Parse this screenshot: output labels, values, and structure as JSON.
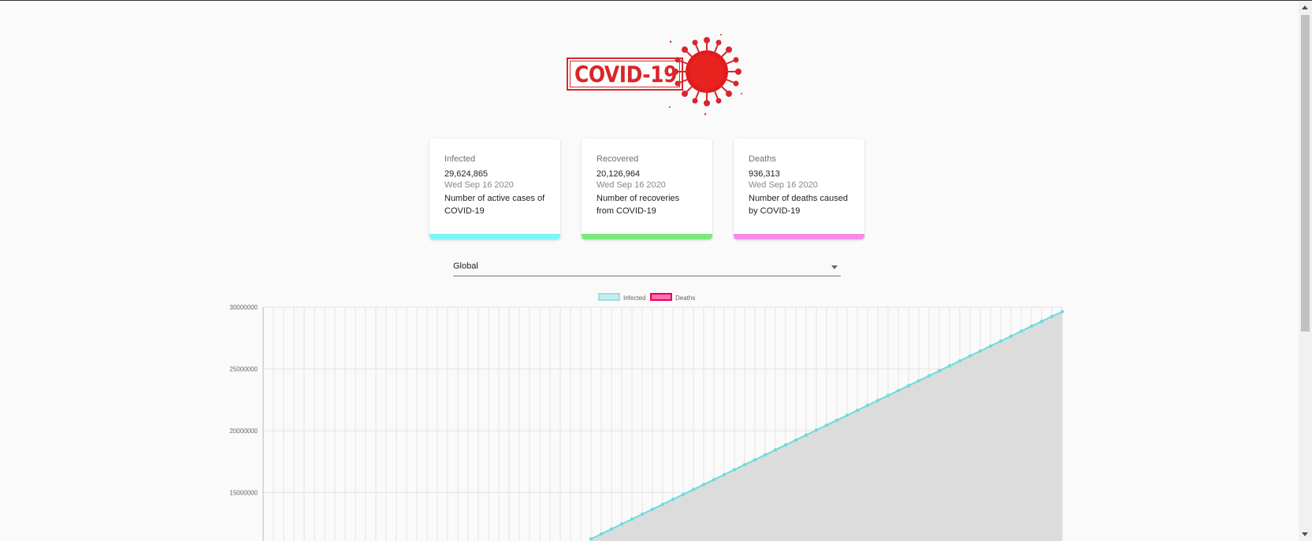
{
  "logo": {
    "text": "COVID-19",
    "icon": "virus-icon",
    "color": "#d8262b"
  },
  "cards": [
    {
      "title": "Infected",
      "value": "29,624,865",
      "date": "Wed Sep 16 2020",
      "desc": "Number of active cases of COVID-19",
      "color": "#7ff4f8"
    },
    {
      "title": "Recovered",
      "value": "20,126,964",
      "date": "Wed Sep 16 2020",
      "desc": "Number of recoveries from COVID-19",
      "color": "#7be87b"
    },
    {
      "title": "Deaths",
      "value": "936,313",
      "date": "Wed Sep 16 2020",
      "desc": "Number of deaths caused by COVID-19",
      "color": "#f48be8"
    }
  ],
  "country_select": {
    "value": "Global"
  },
  "chart_data": {
    "type": "line",
    "legend": [
      {
        "name": "Infected",
        "fill": "#c6ecec",
        "stroke": "#9fdede"
      },
      {
        "name": "Deaths",
        "fill": "#ff6fb5",
        "stroke": "#e8004f"
      }
    ],
    "y_ticks": [
      "30000000",
      "25000000",
      "20000000",
      "15000000"
    ],
    "ylim": [
      11000000,
      30000000
    ],
    "x_categories": 78,
    "series": [
      {
        "name": "Infected",
        "line_color": "#6ddcdc",
        "area_color": "#dcdcdc",
        "values": [
          11250000,
          11650000,
          12050000,
          12450000,
          12850000,
          13250000,
          13650000,
          14050000,
          14450000,
          14850000,
          15250000,
          15650000,
          16050000,
          16450000,
          16850000,
          17250000,
          17650000,
          18050000,
          18450000,
          18850000,
          19250000,
          19650000,
          20050000,
          20450000,
          20850000,
          21250000,
          21650000,
          22050000,
          22450000,
          22850000,
          23250000,
          23650000,
          24050000,
          24450000,
          24850000,
          25250000,
          25650000,
          26050000,
          26450000,
          26850000,
          27250000,
          27650000,
          28050000,
          28450000,
          28850000,
          29250000,
          29624865
        ]
      }
    ],
    "grid": true,
    "legend_position": "top-center"
  }
}
